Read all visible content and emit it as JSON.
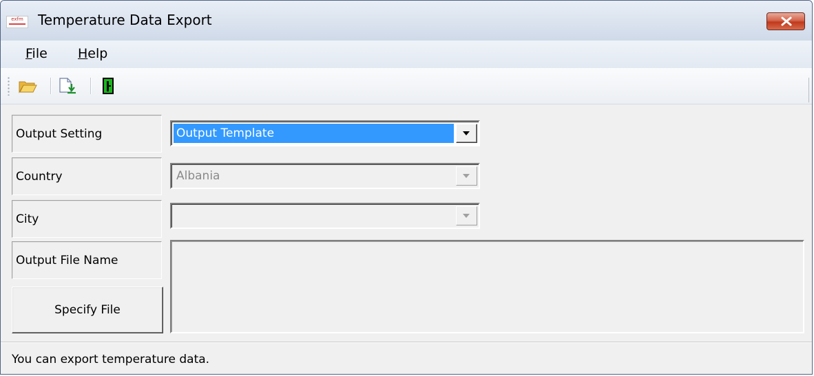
{
  "window": {
    "title": "Temperature Data Export",
    "app_icon_text": "exfm"
  },
  "menu": {
    "items": [
      {
        "label": "File",
        "mnemonic": "F",
        "rest": "ile"
      },
      {
        "label": "Help",
        "mnemonic": "H",
        "rest": "elp"
      }
    ]
  },
  "toolbar": {
    "buttons": [
      {
        "icon": "open-folder-icon"
      },
      {
        "icon": "export-document-icon"
      },
      {
        "icon": "exit-door-icon"
      }
    ]
  },
  "form": {
    "output_setting": {
      "label": "Output Setting",
      "value": "Output Template"
    },
    "country": {
      "label": "Country",
      "value": "Albania"
    },
    "city": {
      "label": "City",
      "value": ""
    },
    "output_file_name": {
      "label": "Output File Name",
      "value": ""
    },
    "specify_file_label": "Specify File"
  },
  "status": {
    "text": "You can export temperature data."
  },
  "colors": {
    "selection": "#3399ff",
    "close_button": "#c2391c",
    "titlebar": "#dde5f0"
  }
}
